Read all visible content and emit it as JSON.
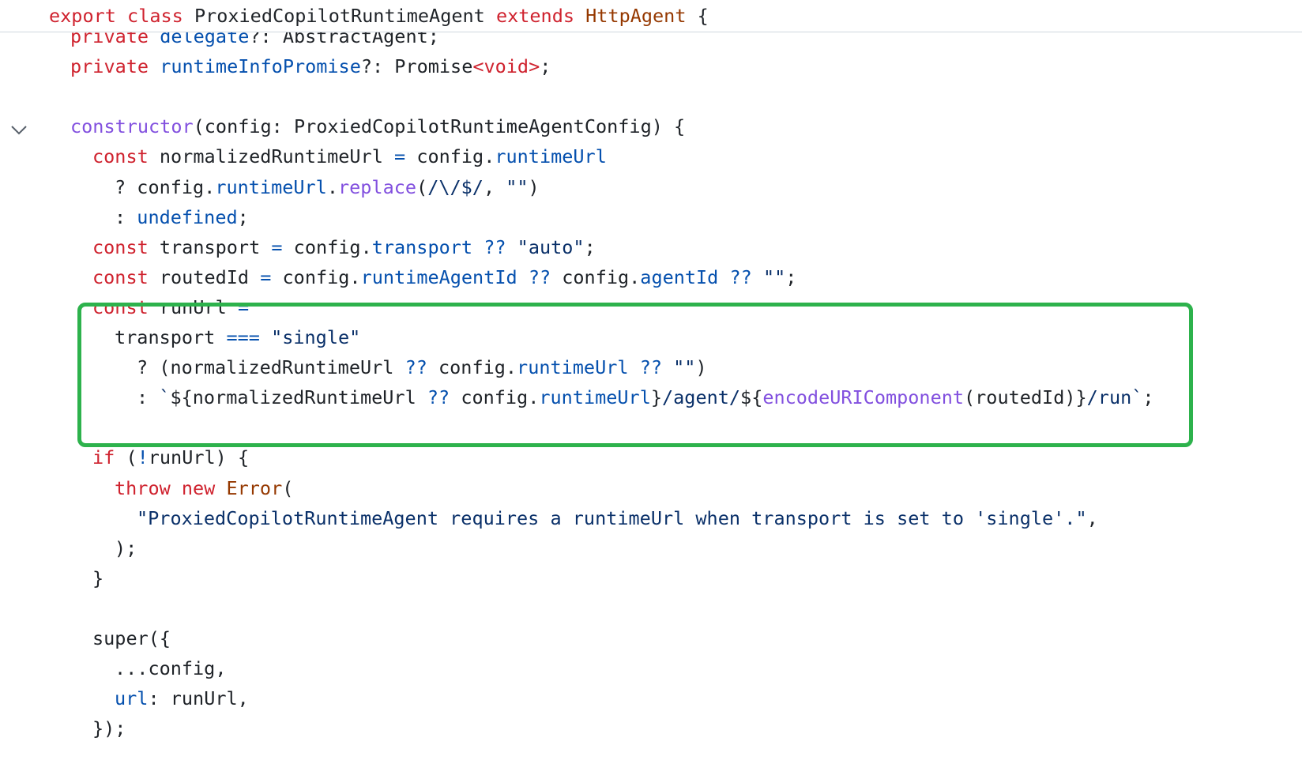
{
  "editor": {
    "sticky_header": [
      {
        "t": "export ",
        "c": "kw"
      },
      {
        "t": "class ",
        "c": "kw"
      },
      {
        "t": "ProxiedCopilotRuntimeAgent ",
        "c": "pl"
      },
      {
        "t": "extends ",
        "c": "kw"
      },
      {
        "t": "HttpAgent",
        "c": "ty"
      },
      {
        "t": " {",
        "c": "pl"
      }
    ],
    "lines": [
      [
        {
          "t": "private ",
          "c": "kw"
        },
        {
          "t": "delegate",
          "c": "pr"
        },
        {
          "t": "?: AbstractAgent;",
          "c": "pl"
        }
      ],
      [
        {
          "t": "private ",
          "c": "kw"
        },
        {
          "t": "runtimeInfoPromise",
          "c": "pr"
        },
        {
          "t": "?: Promise",
          "c": "pl"
        },
        {
          "t": "<void>",
          "c": "kw"
        },
        {
          "t": ";",
          "c": "pl"
        }
      ],
      [],
      [
        {
          "t": "constructor",
          "c": "fn"
        },
        {
          "t": "(config: ProxiedCopilotRuntimeAgentConfig) {",
          "c": "pl"
        }
      ],
      [
        {
          "t": "const ",
          "c": "kw"
        },
        {
          "t": "normalizedRuntimeUrl ",
          "c": "pl"
        },
        {
          "t": "=",
          "c": "pr"
        },
        {
          "t": " config.",
          "c": "pl"
        },
        {
          "t": "runtimeUrl",
          "c": "pr"
        }
      ],
      [
        {
          "t": "? config.",
          "c": "pl"
        },
        {
          "t": "runtimeUrl",
          "c": "pr"
        },
        {
          "t": ".",
          "c": "pl"
        },
        {
          "t": "replace",
          "c": "fn"
        },
        {
          "t": "(",
          "c": "pl"
        },
        {
          "t": "/\\/$/",
          "c": "st"
        },
        {
          "t": ", ",
          "c": "pl"
        },
        {
          "t": "\"\"",
          "c": "st"
        },
        {
          "t": ")",
          "c": "pl"
        }
      ],
      [
        {
          "t": ": ",
          "c": "pl"
        },
        {
          "t": "undefined",
          "c": "pr"
        },
        {
          "t": ";",
          "c": "pl"
        }
      ],
      [
        {
          "t": "const ",
          "c": "kw"
        },
        {
          "t": "transport ",
          "c": "pl"
        },
        {
          "t": "=",
          "c": "pr"
        },
        {
          "t": " config.",
          "c": "pl"
        },
        {
          "t": "transport",
          "c": "pr"
        },
        {
          "t": " ",
          "c": "pl"
        },
        {
          "t": "??",
          "c": "pr"
        },
        {
          "t": " ",
          "c": "pl"
        },
        {
          "t": "\"auto\"",
          "c": "st"
        },
        {
          "t": ";",
          "c": "pl"
        }
      ],
      [
        {
          "t": "const ",
          "c": "kw"
        },
        {
          "t": "routedId ",
          "c": "pl"
        },
        {
          "t": "=",
          "c": "pr"
        },
        {
          "t": " config.",
          "c": "pl"
        },
        {
          "t": "runtimeAgentId",
          "c": "pr"
        },
        {
          "t": " ",
          "c": "pl"
        },
        {
          "t": "??",
          "c": "pr"
        },
        {
          "t": " config.",
          "c": "pl"
        },
        {
          "t": "agentId",
          "c": "pr"
        },
        {
          "t": " ",
          "c": "pl"
        },
        {
          "t": "??",
          "c": "pr"
        },
        {
          "t": " ",
          "c": "pl"
        },
        {
          "t": "\"\"",
          "c": "st"
        },
        {
          "t": ";",
          "c": "pl"
        }
      ],
      [
        {
          "t": "const ",
          "c": "kw"
        },
        {
          "t": "runUrl ",
          "c": "pl"
        },
        {
          "t": "=",
          "c": "pr"
        }
      ],
      [
        {
          "t": "transport ",
          "c": "pl"
        },
        {
          "t": "===",
          "c": "pr"
        },
        {
          "t": " ",
          "c": "pl"
        },
        {
          "t": "\"single\"",
          "c": "st"
        }
      ],
      [
        {
          "t": "? (normalizedRuntimeUrl ",
          "c": "pl"
        },
        {
          "t": "??",
          "c": "pr"
        },
        {
          "t": " config.",
          "c": "pl"
        },
        {
          "t": "runtimeUrl",
          "c": "pr"
        },
        {
          "t": " ",
          "c": "pl"
        },
        {
          "t": "??",
          "c": "pr"
        },
        {
          "t": " ",
          "c": "pl"
        },
        {
          "t": "\"\"",
          "c": "st"
        },
        {
          "t": ")",
          "c": "pl"
        }
      ],
      [
        {
          "t": ": ",
          "c": "pl"
        },
        {
          "t": "`",
          "c": "st"
        },
        {
          "t": "${normalizedRuntimeUrl ",
          "c": "pl"
        },
        {
          "t": "??",
          "c": "pr"
        },
        {
          "t": " config.",
          "c": "pl"
        },
        {
          "t": "runtimeUrl",
          "c": "pr"
        },
        {
          "t": "}",
          "c": "pl"
        },
        {
          "t": "/agent/",
          "c": "st"
        },
        {
          "t": "${",
          "c": "pl"
        },
        {
          "t": "encodeURIComponent",
          "c": "fn"
        },
        {
          "t": "(routedId)}",
          "c": "pl"
        },
        {
          "t": "/run`",
          "c": "st"
        },
        {
          "t": ";",
          "c": "pl"
        }
      ],
      [],
      [
        {
          "t": "if ",
          "c": "kw"
        },
        {
          "t": "(",
          "c": "pl"
        },
        {
          "t": "!",
          "c": "pr"
        },
        {
          "t": "runUrl) {",
          "c": "pl"
        }
      ],
      [
        {
          "t": "throw ",
          "c": "kw"
        },
        {
          "t": "new ",
          "c": "kw"
        },
        {
          "t": "Error",
          "c": "ty"
        },
        {
          "t": "(",
          "c": "pl"
        }
      ],
      [
        {
          "t": "\"ProxiedCopilotRuntimeAgent requires a runtimeUrl when transport is set to 'single'.\"",
          "c": "st"
        },
        {
          "t": ",",
          "c": "pl"
        }
      ],
      [
        {
          "t": ");",
          "c": "pl"
        }
      ],
      [
        {
          "t": "}",
          "c": "pl"
        }
      ],
      [],
      [
        {
          "t": "super",
          "c": "pl"
        },
        {
          "t": "({",
          "c": "pl"
        }
      ],
      [
        {
          "t": "...config,",
          "c": "pl"
        }
      ],
      [
        {
          "t": "url",
          "c": "pr"
        },
        {
          "t": ": runUrl,",
          "c": "pl"
        }
      ],
      [
        {
          "t": "});",
          "c": "pl"
        }
      ]
    ]
  }
}
